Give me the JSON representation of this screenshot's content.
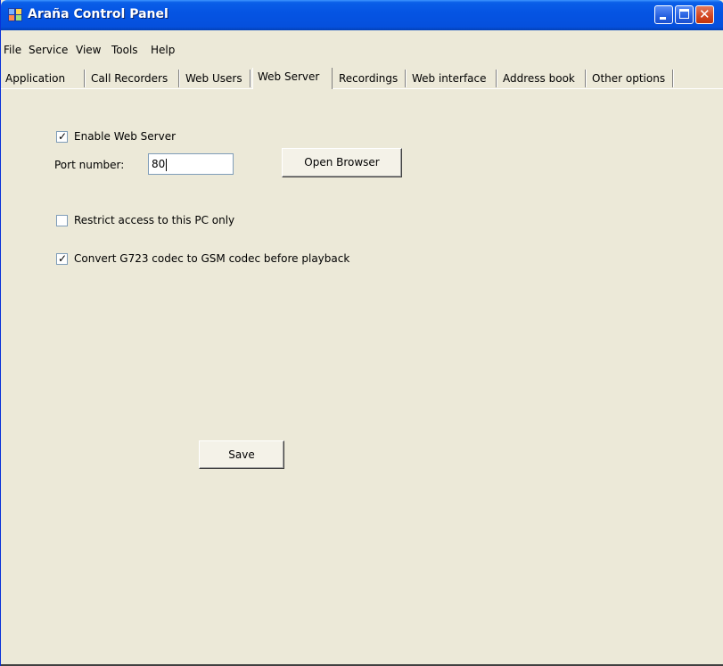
{
  "window": {
    "title": "Araña Control Panel",
    "title_color": "#ffffff",
    "titlebar_color": "#0554e3"
  },
  "menu": [
    "File",
    "Service",
    "View",
    "Tools",
    "Help"
  ],
  "tabs": [
    {
      "label": "Application",
      "active": false
    },
    {
      "label": "Call Recorders",
      "active": false
    },
    {
      "label": "Web Users",
      "active": false
    },
    {
      "label": "Web Server",
      "active": true
    },
    {
      "label": "Recordings",
      "active": false
    },
    {
      "label": "Web interface",
      "active": false
    },
    {
      "label": "Address book",
      "active": false
    },
    {
      "label": "Other options",
      "active": false
    }
  ],
  "web_server": {
    "enable_label": "Enable Web Server",
    "enable_checked": true,
    "port_label": "Port number:",
    "port_value": "80",
    "open_browser_label": "Open Browser",
    "restrict_label": "Restrict access to this PC only",
    "restrict_checked": false,
    "convert_label": "Convert G723 codec to GSM codec before playback",
    "convert_checked": true,
    "save_label": "Save"
  }
}
